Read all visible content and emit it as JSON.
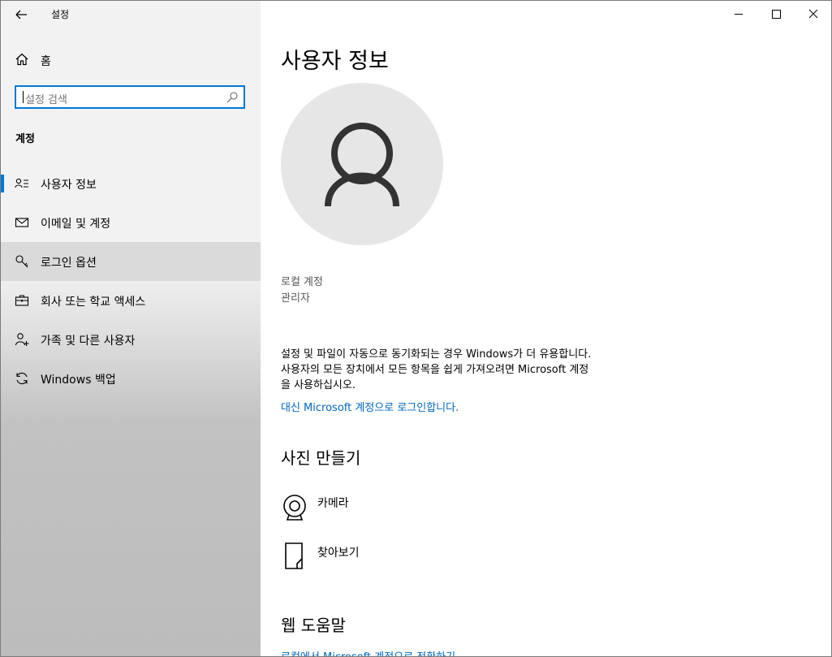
{
  "window": {
    "title": "설정"
  },
  "sidebar": {
    "home_label": "홈",
    "search_placeholder": "설정 검색",
    "section_title": "계정",
    "items": [
      {
        "label": "사용자 정보",
        "icon": "user-info-icon"
      },
      {
        "label": "이메일 및 계정",
        "icon": "mail-icon"
      },
      {
        "label": "로그인 옵션",
        "icon": "key-icon"
      },
      {
        "label": "회사 또는 학교 액세스",
        "icon": "briefcase-icon"
      },
      {
        "label": "가족 및 다른 사용자",
        "icon": "add-user-icon"
      },
      {
        "label": "Windows 백업",
        "icon": "sync-icon"
      }
    ],
    "selected_index": 0,
    "hover_index": 2
  },
  "main": {
    "title": "사용자 정보",
    "account_type": "로컬 계정",
    "account_role": "관리자",
    "description": [
      "설정 및 파일이 자동으로 동기화되는 경우 Windows가 더 유용합니다.",
      "사용자의 모든 장치에서 모든 항목을 쉽게 가져오려면 Microsoft 계정",
      "을 사용하십시오."
    ],
    "ms_signin_link": "대신 Microsoft 계정으로 로그인합니다.",
    "photo_heading": "사진 만들기",
    "photo_options": [
      {
        "label": "카메라",
        "icon": "camera-icon"
      },
      {
        "label": "찾아보기",
        "icon": "browse-file-icon"
      }
    ],
    "help_heading": "웹 도움말",
    "help_link": "로컬에서 Microsoft 계정으로 전환하기"
  },
  "colors": {
    "accent": "#0078d7",
    "link": "#0067c0"
  }
}
